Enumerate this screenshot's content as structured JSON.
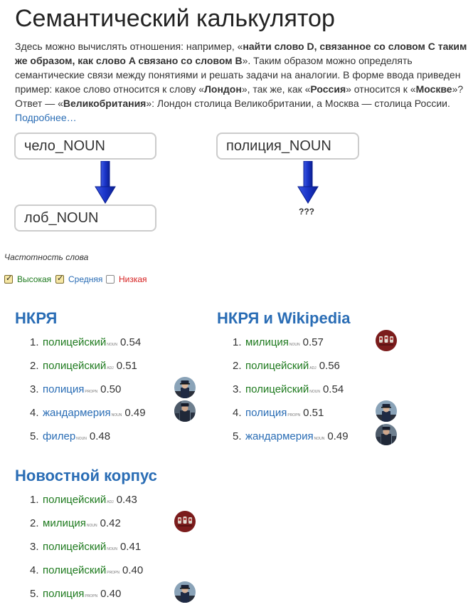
{
  "title": "Семантический калькулятор",
  "intro": {
    "p1": "Здесь можно вычислять отношения: например, «",
    "b1": "найти слово D, связанное со словом C таким же образом, как слово A связано со словом B",
    "p2": "». Таким образом можно определять семантические связи между понятиями и решать задачи на аналогии. В форме ввода приведен пример: какое слово относится к слову «",
    "b2": "Лондон",
    "p3": "», так же, как «",
    "b3": "Россия",
    "p4": "» относится к «",
    "b4": "Москве",
    "p5": "»? Ответ — «",
    "b5": "Великобритания",
    "p6": "»: Лондон столица Великобритании, а Москва — столица России.",
    "more": "Подробнее…"
  },
  "form": {
    "word_a": "чело_NOUN",
    "word_b": "лоб_NOUN",
    "word_c": "полиция_NOUN",
    "answer_placeholder": "???"
  },
  "frequency": {
    "caption": "Частотность слова",
    "high": "Высокая",
    "mid": "Средняя",
    "low": "Низкая",
    "high_checked": true,
    "mid_checked": true,
    "low_checked": false
  },
  "colors": {
    "accent": "#2a6db5",
    "high": "#1e7a1e",
    "low": "#d62020",
    "arrow": "#1433c4"
  },
  "sections": {
    "nkrya": {
      "title": "НКРЯ",
      "items": [
        {
          "num": "1.",
          "word": "полицейский",
          "pos": "NOUN",
          "score": "0.54",
          "color": "green",
          "thumb": ""
        },
        {
          "num": "2.",
          "word": "полицейский",
          "pos": "ADJ",
          "score": "0.51",
          "color": "green",
          "thumb": ""
        },
        {
          "num": "3.",
          "word": "полиция",
          "pos": "PROPN",
          "score": "0.50",
          "color": "blue",
          "thumb": "policeman"
        },
        {
          "num": "4.",
          "word": "жандармерия",
          "pos": "NOUN",
          "score": "0.49",
          "color": "blue",
          "thumb": "gendarme"
        },
        {
          "num": "5.",
          "word": "филер",
          "pos": "NOUN",
          "score": "0.48",
          "color": "blue",
          "thumb": ""
        }
      ]
    },
    "wiki": {
      "title": "НКРЯ и Wikipedia",
      "items": [
        {
          "num": "1.",
          "word": "милиция",
          "pos": "NOUN",
          "score": "0.57",
          "color": "green",
          "thumb": "badges"
        },
        {
          "num": "2.",
          "word": "полицейский",
          "pos": "ADJ",
          "score": "0.56",
          "color": "green",
          "thumb": ""
        },
        {
          "num": "3.",
          "word": "полицейский",
          "pos": "NOUN",
          "score": "0.54",
          "color": "green",
          "thumb": ""
        },
        {
          "num": "4.",
          "word": "полиция",
          "pos": "PROPN",
          "score": "0.51",
          "color": "blue",
          "thumb": "policeman"
        },
        {
          "num": "5.",
          "word": "жандармерия",
          "pos": "NOUN",
          "score": "0.49",
          "color": "blue",
          "thumb": "gendarme"
        }
      ]
    },
    "news": {
      "title": "Новостной корпус",
      "items": [
        {
          "num": "1.",
          "word": "полицейский",
          "pos": "ADJ",
          "score": "0.43",
          "color": "green",
          "thumb": ""
        },
        {
          "num": "2.",
          "word": "милиция",
          "pos": "NOUN",
          "score": "0.42",
          "color": "green",
          "thumb": "badges"
        },
        {
          "num": "3.",
          "word": "полицейский",
          "pos": "NOUN",
          "score": "0.41",
          "color": "green",
          "thumb": ""
        },
        {
          "num": "4.",
          "word": "полицейский",
          "pos": "PROPN",
          "score": "0.40",
          "color": "green",
          "thumb": ""
        },
        {
          "num": "5.",
          "word": "полиция",
          "pos": "PROPN",
          "score": "0.40",
          "color": "green",
          "thumb": "policeman"
        }
      ]
    }
  }
}
